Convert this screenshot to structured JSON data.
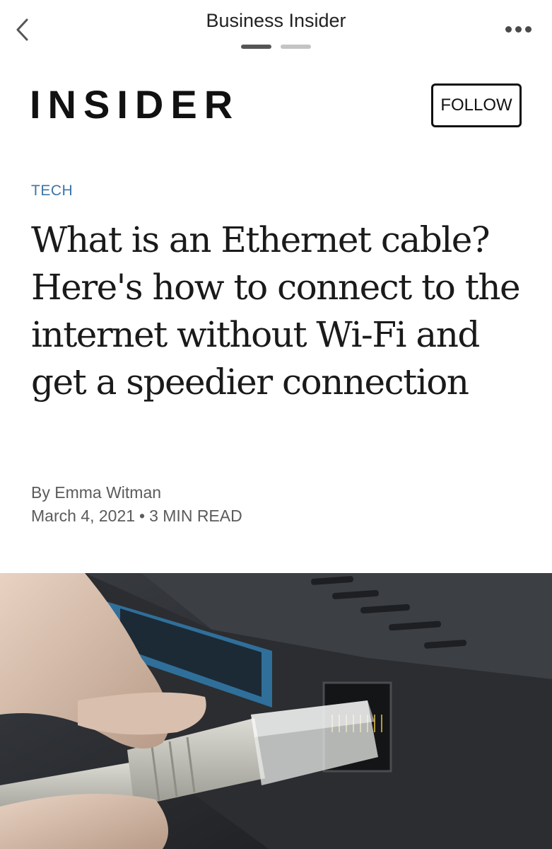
{
  "topbar": {
    "title": "Business Insider",
    "back_icon": "chevron-left-icon",
    "more_icon": "more-horizontal-icon",
    "pages_total": 2,
    "page_current": 1
  },
  "publisher": {
    "logo_text": "INSIDER",
    "follow_label": "FOLLOW"
  },
  "article": {
    "category": "TECH",
    "category_color": "#3f74a6",
    "headline": "What is an Ethernet cable? Here's how to connect to the internet without Wi-Fi and get a speedier connection",
    "byline": "By Emma Witman",
    "date": "March 4, 2021",
    "separator": "•",
    "read_time": "3 MIN READ"
  },
  "hero_image": {
    "subject": "hand-plugging-ethernet-cable-into-router"
  }
}
